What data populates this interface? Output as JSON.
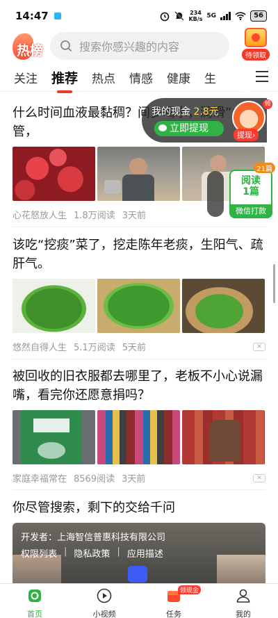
{
  "status_bar": {
    "time": "14:47",
    "net_speed_value": "234",
    "net_speed_unit": "KB/s",
    "network": "5G",
    "battery": "56"
  },
  "header": {
    "logo_text": "热榜",
    "search_placeholder": "搜索你感兴趣的内容",
    "reward_label": "待领取"
  },
  "tabs": {
    "items": [
      "关注",
      "推荐",
      "热点",
      "情感",
      "健康",
      "生"
    ],
    "active": "推荐"
  },
  "money_widget": {
    "label": "我的现金",
    "amount": "2.8元",
    "withdraw_label": "立即提现",
    "mascot_tip": "提现",
    "mascot_badge": "领"
  },
  "read_widget": {
    "badge": "21篇",
    "line1": "阅读",
    "line2": "1篇",
    "footer": "微信打款"
  },
  "articles": [
    {
      "title": "什么时间血液最黏稠？间多喝水，润滑”血管，",
      "source": "心花怒放人生",
      "reads": "1.8万阅读",
      "time": "3天前"
    },
    {
      "title": "该吃“挖痰”菜了，挖走陈年老痰，生阳气、疏肝气。",
      "source": "悠然自得人生",
      "reads": "5.1万阅读",
      "time": "5天前"
    },
    {
      "title": "被回收的旧衣服都去哪里了，老板不小心说漏嘴，看完你还愿意捐吗？",
      "source": "家庭幸福常在",
      "reads": "8569阅读",
      "time": "3天前"
    },
    {
      "title": "你尽管搜索，剩下的交给千问"
    }
  ],
  "ad": {
    "developer": "开发者：上海智信普惠科技有限公司",
    "links": [
      "权限列表",
      "隐私政策",
      "应用描述"
    ]
  },
  "bottom_nav": {
    "items": [
      "首页",
      "小视频",
      "任务",
      "我的"
    ],
    "task_tag": "领现金"
  },
  "colors": {
    "accent_red": "#f0352a",
    "accent_green": "#2fb344"
  }
}
